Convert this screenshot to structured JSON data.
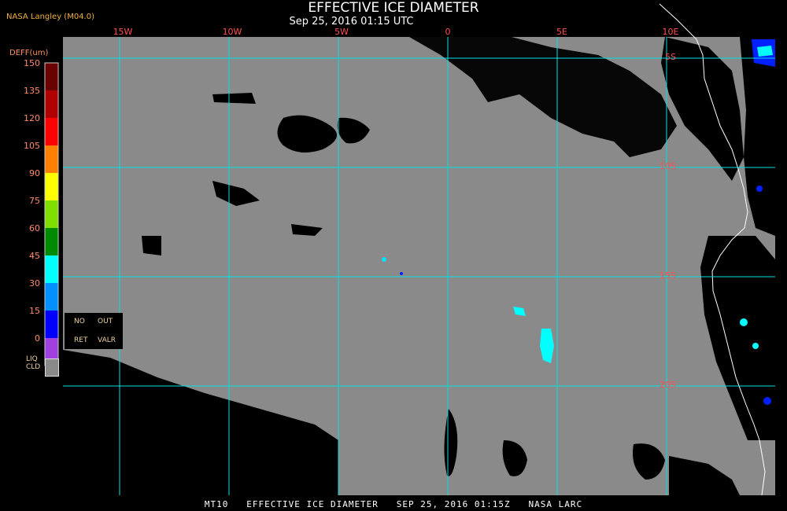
{
  "header": {
    "title": "EFFECTIVE ICE DIAMETER",
    "subtitle": "Sep 25, 2016 01:15 UTC",
    "organization": "NASA Langley (M04.0)"
  },
  "legend": {
    "title": "DEFF(um)",
    "labels": [
      "150",
      "135",
      "120",
      "105",
      "90",
      "75",
      "60",
      "45",
      "30",
      "15",
      "0"
    ],
    "colors": [
      "#6a0000",
      "#b00000",
      "#ff0000",
      "#ff8000",
      "#ffff00",
      "#7fe000",
      "#008a00",
      "#00ffff",
      "#0090ff",
      "#0000ff",
      "#a040e0"
    ],
    "no_retrieval": {
      "no": "NO",
      "out": "OUT",
      "ret": "RET",
      "valr": "VALR"
    },
    "liquid_cloud": {
      "line1": "LIQ",
      "line2": "CLD",
      "color": "#8a8a8a"
    }
  },
  "map": {
    "longitude_labels": [
      "15W",
      "10W",
      "5W",
      "0",
      "5E",
      "10E"
    ],
    "latitude_labels": [
      "5S",
      "10S",
      "15S",
      "20S"
    ],
    "grid_color": "#00e0e0",
    "liquid_cloud_color": "#8a8a8a",
    "clear_color": "#000000",
    "coastline_color": "#ffffff"
  },
  "footer": {
    "text": "MT10   EFFECTIVE ICE DIAMETER   SEP 25, 2016 01:15Z   NASA LARC"
  }
}
